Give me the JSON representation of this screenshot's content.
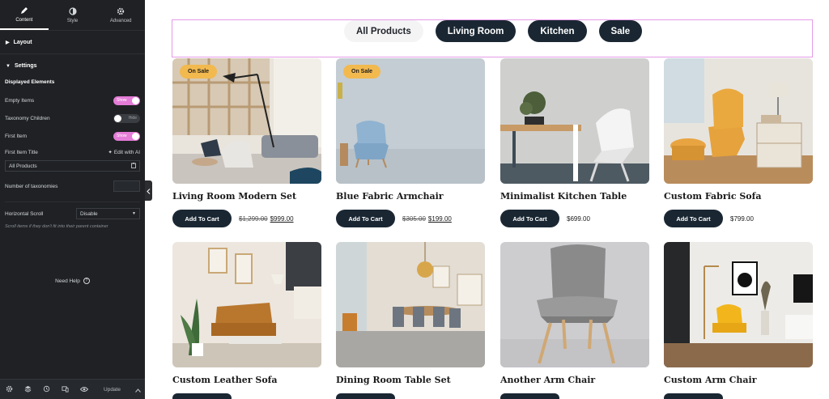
{
  "panel": {
    "tabs": [
      {
        "label": "Content",
        "icon": "pencil-icon"
      },
      {
        "label": "Style",
        "icon": "half-circle-icon"
      },
      {
        "label": "Advanced",
        "icon": "gear-icon"
      }
    ],
    "layout_section": "Layout",
    "settings_section": "Settings",
    "displayed_elements": "Displayed Elements",
    "empty_items": {
      "label": "Empty Items",
      "toggle": "Show"
    },
    "taxonomy_children": {
      "label": "Taxonomy Children",
      "toggle": "Hide"
    },
    "first_item": {
      "label": "First Item",
      "toggle": "Show"
    },
    "first_item_title": {
      "label": "First Item Title",
      "ai_link": "Edit with AI",
      "value": "All Products"
    },
    "num_taxonomies": {
      "label": "Number of taxonomies"
    },
    "horizontal_scroll": {
      "label": "Horizontal Scroll",
      "value": "Disable",
      "hint": "Scroll items if they don't fit into their parent container"
    },
    "need_help": "Need Help",
    "footer": {
      "update": "Update"
    }
  },
  "filters": [
    "All Products",
    "Living Room",
    "Kitchen",
    "Sale"
  ],
  "products": [
    {
      "title": "Living Room Modern Set",
      "badge": "On Sale",
      "cart": "Add To Cart",
      "old_price": "$1,299.00",
      "price": "$999.00"
    },
    {
      "title": "Blue Fabric Armchair",
      "badge": "On Sale",
      "cart": "Add To Cart",
      "old_price": "$305.00",
      "price": "$199.00"
    },
    {
      "title": "Minimalist Kitchen Table",
      "cart": "Add To Cart",
      "price": "$699.00"
    },
    {
      "title": "Custom Fabric Sofa",
      "cart": "Add To Cart",
      "price": "$799.00"
    },
    {
      "title": "Custom Leather Sofa"
    },
    {
      "title": "Dining Room Table Set"
    },
    {
      "title": "Another Arm Chair"
    },
    {
      "title": "Custom Arm Chair"
    }
  ],
  "colors": {
    "panel_bg": "#1f2124",
    "toggle_on": "#e47cd7",
    "button_dark": "#1a2733",
    "sale_badge": "#f2b94f",
    "selection_outline": "#e59be8"
  }
}
